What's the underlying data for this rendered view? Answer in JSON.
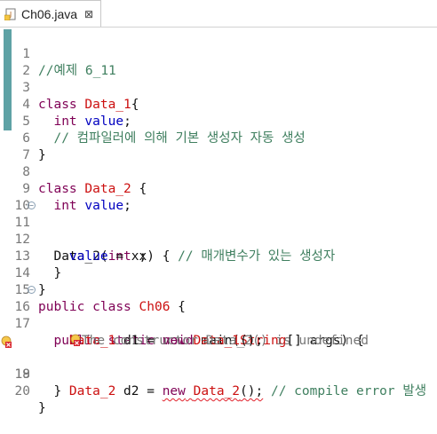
{
  "tab": {
    "filename": "Ch06.java",
    "close": "⊠",
    "icon": "java-file-icon"
  },
  "colors": {
    "keyword": "#7f0055",
    "class_name": "#cc1010",
    "field": "#0000c0",
    "comment": "#3f7f5f",
    "change_bar": "#5ea2a5",
    "error": "#e0202a"
  },
  "lines": [
    {
      "num": "1",
      "comment": "//예제 6_11"
    },
    {
      "num": "2"
    },
    {
      "num": "3",
      "kw": "class",
      "name": "Data_1",
      "rest": "{"
    },
    {
      "num": "4",
      "kw": "int",
      "field": "value",
      "rest": ";"
    },
    {
      "num": "5",
      "comment": "// 컴파일러에 의해 기본 생성자 자동 생성"
    },
    {
      "num": "6",
      "rest": "}"
    },
    {
      "num": "7"
    },
    {
      "num": "8",
      "kw": "class",
      "name": "Data_2",
      "rest": "{"
    },
    {
      "num": "9",
      "kw": "int",
      "field": "value",
      "rest": ";"
    },
    {
      "num": "10"
    },
    {
      "num": "11",
      "ctor": "Data_2(",
      "kw": "int",
      "param": "x) {",
      "comment": "// 매개변수가 있는 생성자"
    },
    {
      "num": "12",
      "field": "value",
      "rest": "= x;"
    },
    {
      "num": "13",
      "rest": "}"
    },
    {
      "num": "14",
      "rest": "}"
    },
    {
      "num": "15",
      "kw": "public",
      "kw2": "class",
      "name": "Ch06",
      "rest": "{"
    },
    {
      "num": "16",
      "kw": "public",
      "kw2": "static",
      "kw3": "void",
      "method": "main(",
      "type": "String",
      "rest": "[] args) {"
    },
    {
      "num": "17",
      "type": "Data_1",
      "var": "d1 =",
      "kw": "new",
      "name": "Data_1",
      "rest": "();"
    },
    {
      "hint": "The constructor Data_2() is undefined"
    },
    {
      "num": "18",
      "type": "Data_2",
      "var": "d2 =",
      "kw": "new",
      "name": "Data_2",
      "rest": "();",
      "comment": "// compile error 발생"
    },
    {
      "num": "19",
      "rest": "}"
    },
    {
      "num": "20",
      "rest": "}"
    }
  ]
}
